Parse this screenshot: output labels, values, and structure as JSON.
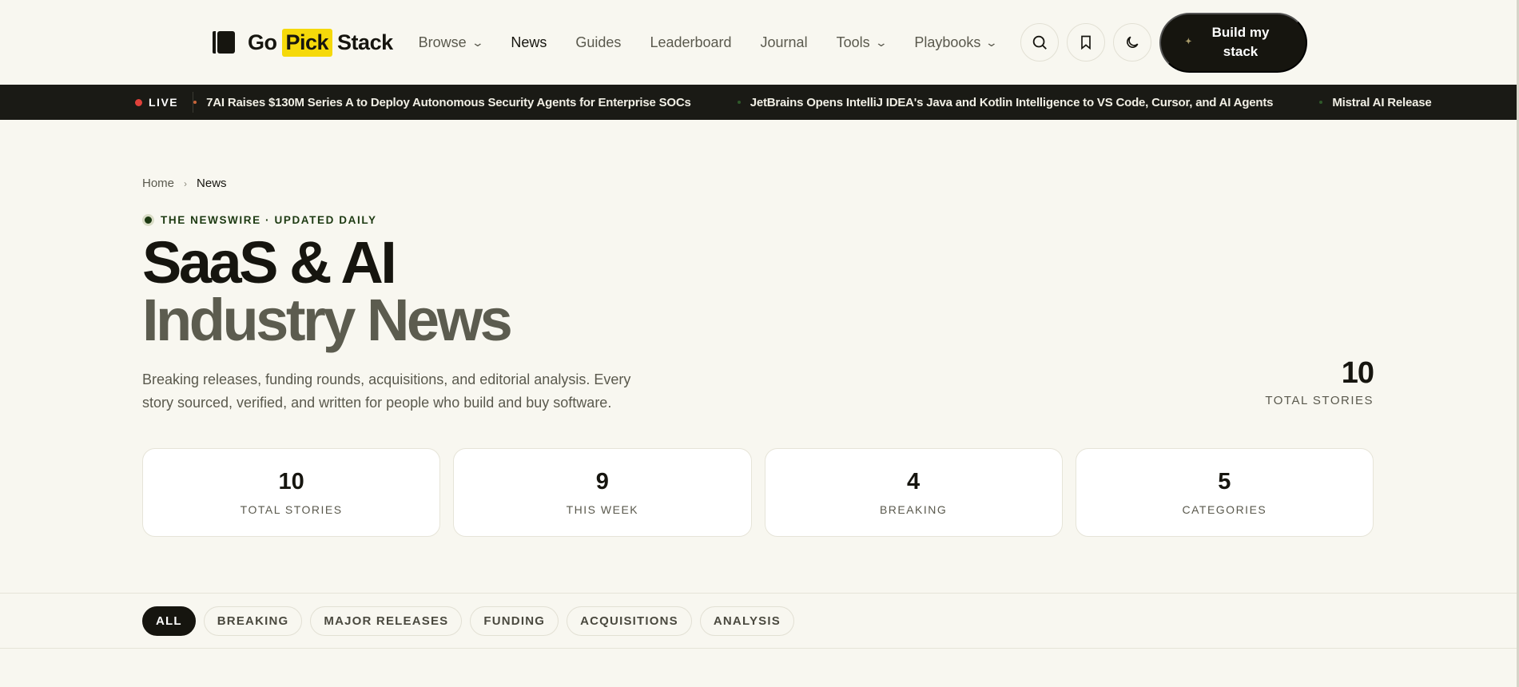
{
  "header": {
    "logo": {
      "go": "Go",
      "pick": "Pick",
      "stack": "Stack"
    },
    "nav": [
      {
        "label": "Browse",
        "dropdown": true,
        "active": false
      },
      {
        "label": "News",
        "dropdown": false,
        "active": true
      },
      {
        "label": "Guides",
        "dropdown": false,
        "active": false
      },
      {
        "label": "Leaderboard",
        "dropdown": false,
        "active": false
      },
      {
        "label": "Journal",
        "dropdown": false,
        "active": false
      },
      {
        "label": "Tools",
        "dropdown": true,
        "active": false
      },
      {
        "label": "Playbooks",
        "dropdown": true,
        "active": false
      }
    ],
    "icons": [
      "search-icon",
      "bookmark-icon",
      "moon-icon"
    ],
    "cta_label": "Build my stack"
  },
  "ticker": {
    "live_label": "LIVE",
    "items": [
      {
        "text": "7AI Raises $130M Series A to Deploy Autonomous Security Agents for Enterprise SOCs",
        "dot_color": "#c8643a"
      },
      {
        "text": "JetBrains Opens IntelliJ IDEA's Java and Kotlin Intelligence to VS Code, Cursor, and AI Agents",
        "dot_color": "#2f5a2a"
      },
      {
        "text": "Mistral AI Release",
        "dot_color": "#2f5a2a"
      }
    ]
  },
  "breadcrumb": {
    "home": "Home",
    "current": "News"
  },
  "kicker": "THE NEWSWIRE · UPDATED DAILY",
  "title": {
    "line1": "SaaS & AI",
    "line2": "Industry News"
  },
  "subtitle": "Breaking releases, funding rounds, acquisitions, and editorial analysis. Every story sourced, verified, and written for people who build and buy software.",
  "total": {
    "value": "10",
    "label": "TOTAL STORIES"
  },
  "stats": [
    {
      "value": "10",
      "label": "TOTAL STORIES"
    },
    {
      "value": "9",
      "label": "THIS WEEK"
    },
    {
      "value": "4",
      "label": "BREAKING"
    },
    {
      "value": "5",
      "label": "CATEGORIES"
    }
  ],
  "filters": [
    {
      "label": "ALL",
      "active": true
    },
    {
      "label": "BREAKING",
      "active": false
    },
    {
      "label": "MAJOR RELEASES",
      "active": false
    },
    {
      "label": "FUNDING",
      "active": false
    },
    {
      "label": "ACQUISITIONS",
      "active": false
    },
    {
      "label": "ANALYSIS",
      "active": false
    }
  ]
}
